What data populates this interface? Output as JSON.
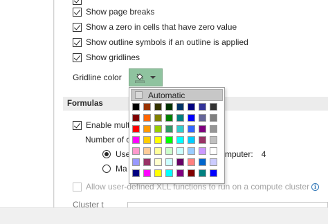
{
  "display_options": [
    {
      "label": "Show page breaks",
      "checked": true
    },
    {
      "label": "Show a zero in cells that have zero value",
      "checked": true
    },
    {
      "label": "Show outline symbols if an outline is applied",
      "checked": true
    },
    {
      "label": "Show gridlines",
      "checked": true
    }
  ],
  "gridline_color": {
    "label": "Gridline color",
    "button_color": "#8fc39f",
    "icon": "paint-bucket-icon",
    "dropdown_icon": "chevron-down-icon"
  },
  "formulas": {
    "header": "Formulas",
    "enable_label": "Enable mult",
    "number_label": "Number of c",
    "radio_use_label": "Use",
    "computer_label": "mputer:",
    "computer_value": "4",
    "radio_manual_label": "Ma",
    "xll_label": "Allow user-defined XLL functions to run on a compute cluster",
    "info_icon": "info-icon",
    "cluster_label": "Cluster t"
  },
  "color_picker": {
    "automatic_label": "Automatic",
    "palette": [
      [
        "#000000",
        "#993300",
        "#333300",
        "#003300",
        "#003366",
        "#000080",
        "#333399",
        "#333333"
      ],
      [
        "#800000",
        "#ff6600",
        "#808000",
        "#008000",
        "#008080",
        "#0000ff",
        "#666699",
        "#808080"
      ],
      [
        "#ff0000",
        "#ff9900",
        "#99cc00",
        "#339966",
        "#33cccc",
        "#3366ff",
        "#800080",
        "#969696"
      ],
      [
        "#ff00ff",
        "#ffcc00",
        "#ffff00",
        "#00ff00",
        "#00ffff",
        "#00ccff",
        "#993366",
        "#c0c0c0"
      ],
      [
        "#ff99cc",
        "#ffcc99",
        "#ffff99",
        "#ccffcc",
        "#ccffff",
        "#99ccff",
        "#cc99ff",
        "#ffffff"
      ],
      [
        "#9999ff",
        "#993366",
        "#ffffcc",
        "#ccffff",
        "#660066",
        "#ff8080",
        "#0066cc",
        "#ccccff"
      ],
      [
        "#000080",
        "#ff00ff",
        "#ffff00",
        "#00ffff",
        "#800080",
        "#800000",
        "#008080",
        "#0000ff"
      ]
    ]
  }
}
